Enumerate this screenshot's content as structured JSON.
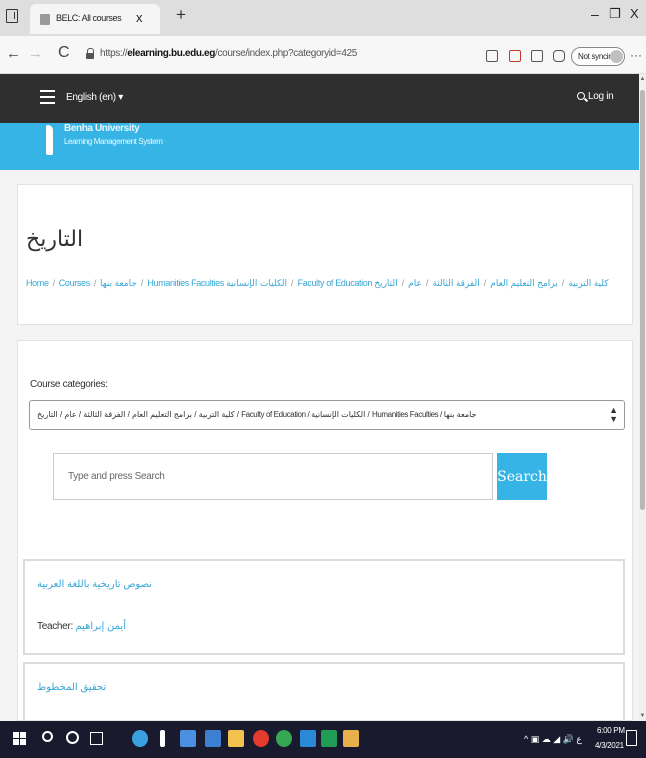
{
  "browser": {
    "tab_title": "BELC: All courses",
    "tab_close": "x",
    "new_tab": "+",
    "url_prefix": "https://",
    "url_host": "elearning.bu.edu.eg",
    "url_path": "/course/index.php?categoryid=425",
    "sync_label": "Not syncing",
    "more": "···",
    "back": "←",
    "forward": "→",
    "reload": "C",
    "minimize": "–",
    "maximize": "❐",
    "close": "X"
  },
  "site": {
    "language": "English (en) ▾",
    "login": "Log in",
    "logo_name": "Benha University",
    "logo_tagline": "Learning Management System"
  },
  "page": {
    "title": "التاريخ",
    "breadcrumb": [
      "Home",
      "Courses",
      "جامعة بنها",
      "Humanities Faculties الكليات الإنسانية",
      "Faculty of Education كلية التربية",
      "برامج التعليم العام",
      "الفرقة الثالثة",
      "عام",
      "التاريخ"
    ]
  },
  "categories": {
    "label": "Course categories:",
    "selected": "كلية التربية / برامج التعليم العام / الفرقة الثالثة / عام / التاريخ / Faculty of Education / الكليات الإنسانية / Humanities Faculties / جامعة بنها"
  },
  "search": {
    "placeholder": "Type and press Search",
    "button": "Search"
  },
  "courses": [
    {
      "name": "نصوص تاريخية باللغة العربية",
      "teacher_label": "Teacher:",
      "teacher": "أيمن إبراهيم"
    },
    {
      "name": "تحقيق المخطوط"
    }
  ],
  "taskbar": {
    "tray": "^ ▣ ☁ ◢ 🔊 ع",
    "time": "6:00 PM",
    "date": "4/3/2021"
  },
  "colors": {
    "accent": "#36b4e5",
    "header_dark": "#2f2f2f",
    "link": "#36a6d6"
  }
}
